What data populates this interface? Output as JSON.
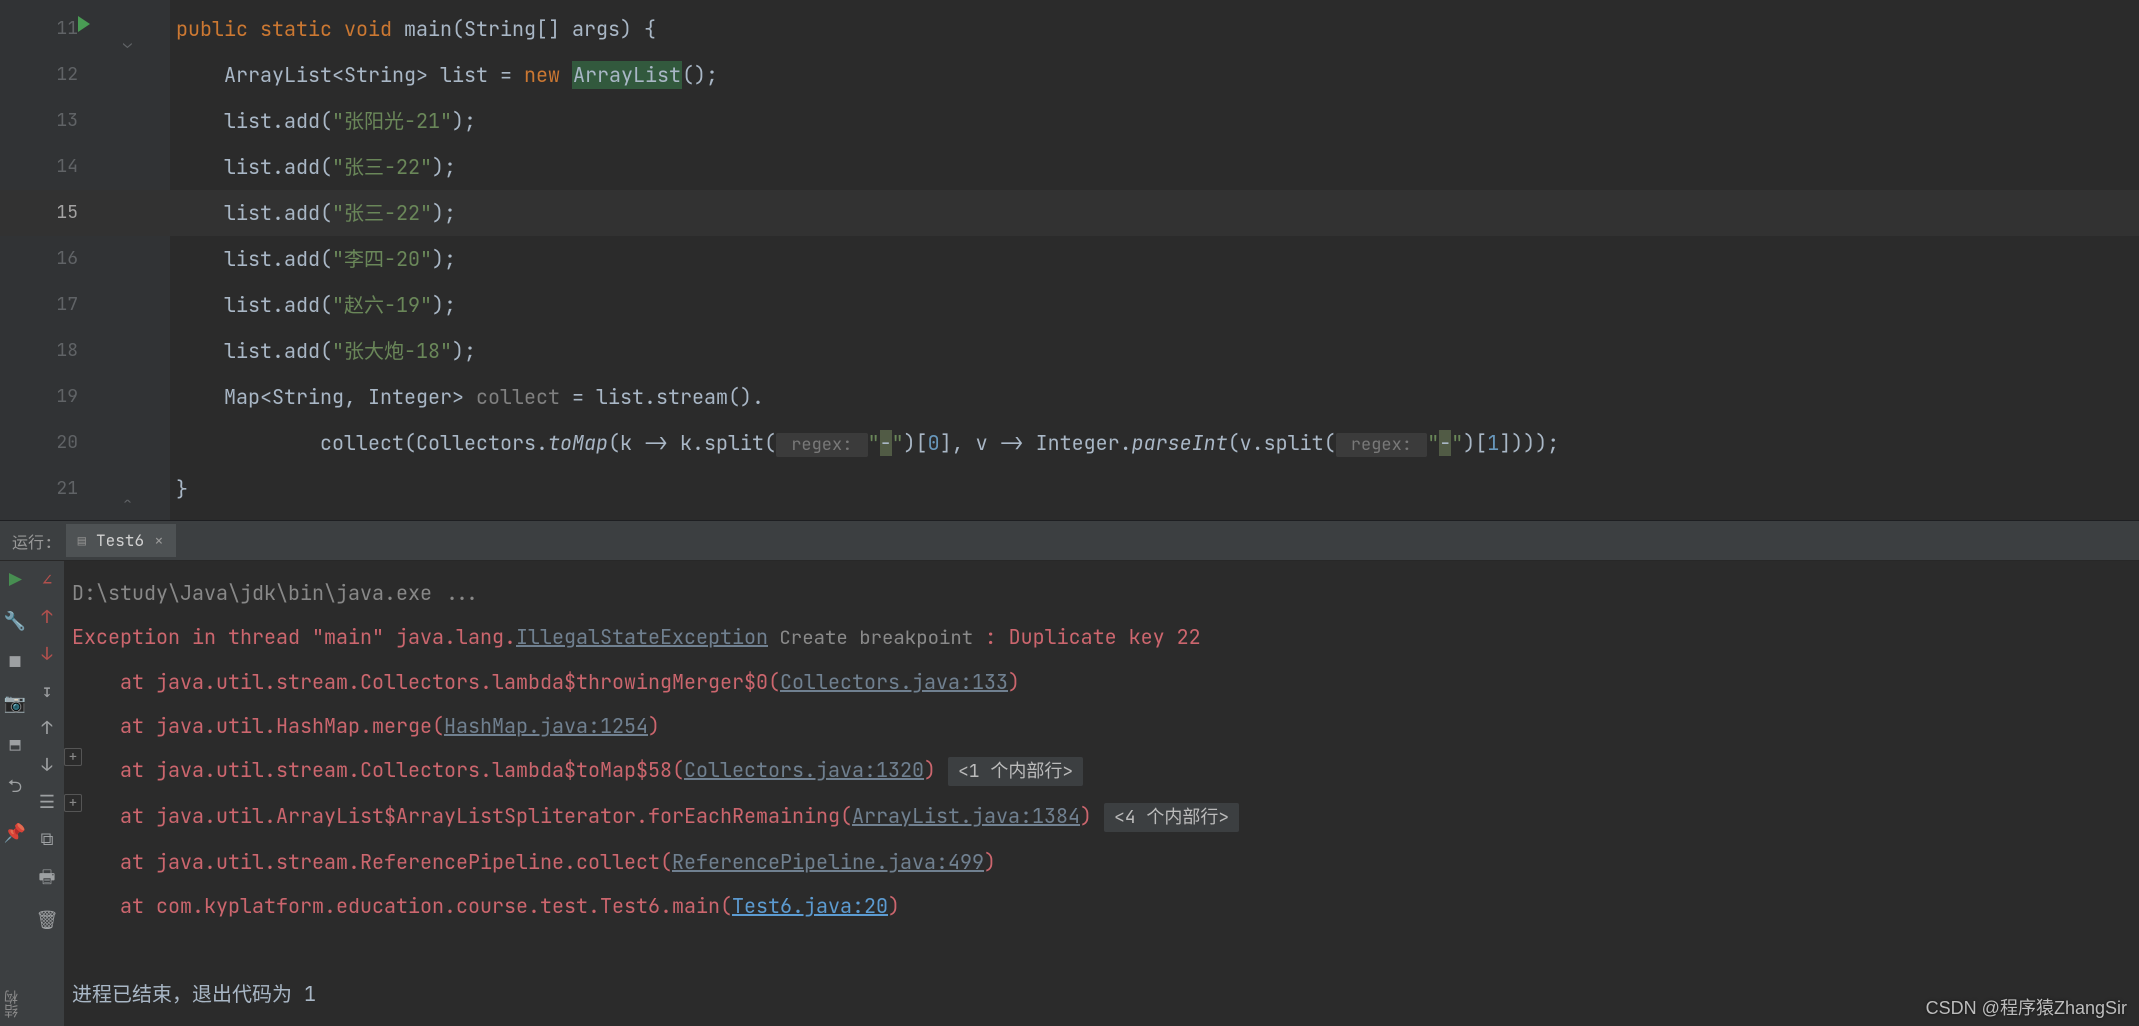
{
  "editor": {
    "lines": [
      {
        "n": 11,
        "run": true,
        "fold": "{",
        "html": "<span class='kw'>public static void</span> main(String[] args) {"
      },
      {
        "n": 12,
        "html": "    ArrayList&lt;String&gt; list = <span class='kw'>new</span> <span class='hlw'>ArrayList</span>();"
      },
      {
        "n": 13,
        "html": "    list.add(<span class='str'>\"张阳光-21\"</span>);"
      },
      {
        "n": 14,
        "html": "    list.add(<span class='str'>\"张三-22\"</span>);"
      },
      {
        "n": 15,
        "active": true,
        "html": "    list.add(<span class='str'>\"张三-22\"</span>);"
      },
      {
        "n": 16,
        "html": "    list.add(<span class='str'>\"李四-20\"</span>);"
      },
      {
        "n": 17,
        "html": "    list.add(<span class='str'>\"赵六-19\"</span>);"
      },
      {
        "n": 18,
        "html": "    list.add(<span class='str'>\"张大炮-18\"</span>);"
      },
      {
        "n": 19,
        "html": "    Map&lt;String, Integer&gt; <span class='gray'>collect</span> = list.stream()."
      },
      {
        "n": 20,
        "html": "            collect(Collectors.<span class='id-it'>toMap</span>(k -&gt; k.split(<span class='hint'> regex: </span><span class='str'>\"</span><span class='hl'>-</span><span class='str'>\"</span>)[<span class='num'>0</span>], v -&gt; Integer.<span class='id-it'>parseInt</span>(v.split(<span class='hint'> regex: </span><span class='str'>\"</span><span class='hl'>-</span><span class='str'>\"</span>)[<span class='num'>1</span>])));"
      },
      {
        "n": 21,
        "fold": "}",
        "html": "}"
      }
    ]
  },
  "run": {
    "title_label": "运行:",
    "tab_name": "Test6",
    "toolbar1": [
      "run",
      "wrench",
      "stop",
      "camera",
      "layout",
      "back",
      "pin"
    ],
    "toolbar2": [
      "diff",
      "up-red",
      "down-red",
      "sort",
      "up",
      "down",
      "tree",
      "mute",
      "print",
      "trash"
    ],
    "cmd": "D:\\study\\Java\\jdk\\bin\\java.exe ...",
    "exc_prefix": "Exception in thread \"main\" java.lang.",
    "exc_link": "IllegalStateException",
    "bp_label": " Create breakpoint ",
    "exc_suffix": ": Duplicate key 22",
    "stack": [
      {
        "pre": "    at java.util.stream.Collectors.lambda$throwingMerger$0(",
        "lnk": "Collectors.java:133",
        "post": ")"
      },
      {
        "pre": "    at java.util.HashMap.merge(",
        "lnk": "HashMap.java:1254",
        "post": ")"
      },
      {
        "pre": "    at java.util.stream.Collectors.lambda$toMap$58(",
        "lnk": "Collectors.java:1320",
        "post": ")",
        "pill": "<1 个内部行>",
        "exp": true
      },
      {
        "pre": "    at java.util.ArrayList$ArrayListSpliterator.forEachRemaining(",
        "lnk": "ArrayList.java:1384",
        "post": ")",
        "pill": "<4 个内部行>",
        "exp": true
      },
      {
        "pre": "    at java.util.stream.ReferencePipeline.collect(",
        "lnk": "ReferencePipeline.java:499",
        "post": ")"
      },
      {
        "pre": "    at com.kyplatform.education.course.test.Test6.main(",
        "lnk": "Test6.java:20",
        "post": ")",
        "blue": true
      }
    ],
    "exit": "进程已结束，退出代码为 1"
  },
  "side_label": "结构",
  "watermark": "CSDN @程序猿ZhangSir"
}
